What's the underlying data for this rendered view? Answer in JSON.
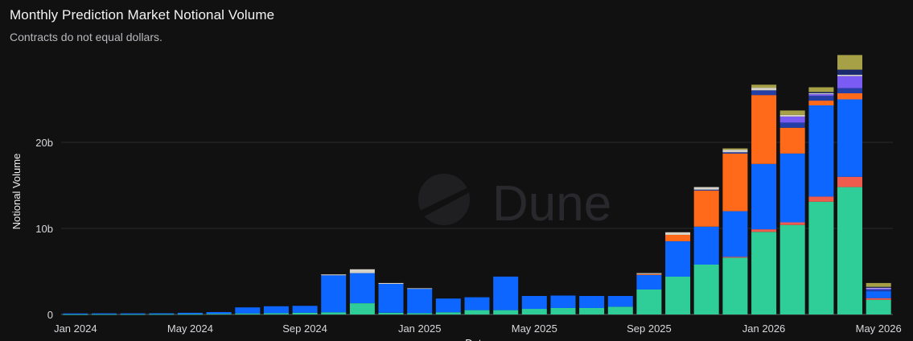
{
  "header": {
    "title": "Monthly Prediction Market Notional Volume",
    "subtitle": "Contracts do not equal dollars."
  },
  "watermark": {
    "text": "Dune",
    "icon": "dune-logo-icon"
  },
  "chart_data": {
    "type": "bar",
    "stacked": true,
    "title": "Monthly Prediction Market Notional Volume",
    "subtitle": "Contracts do not equal dollars.",
    "ylabel": "Notional Volume",
    "xlabel": "Date",
    "ylim": [
      0,
      30
    ],
    "y_unit": "b",
    "yticks": [
      {
        "value": 0,
        "label": "0"
      },
      {
        "value": 10,
        "label": "10b"
      },
      {
        "value": 20,
        "label": "20b"
      }
    ],
    "xtick_labels": [
      {
        "index": 0,
        "label": "Jan 2024"
      },
      {
        "index": 4,
        "label": "May 2024"
      },
      {
        "index": 8,
        "label": "Sep 2024"
      },
      {
        "index": 12,
        "label": "Jan 2025"
      },
      {
        "index": 16,
        "label": "May 2025"
      },
      {
        "index": 20,
        "label": "Sep 2025"
      },
      {
        "index": 24,
        "label": "Jan 2026"
      },
      {
        "index": 28,
        "label": "May 2026"
      }
    ],
    "grid": true,
    "legend": "none",
    "categories": [
      "2024-01",
      "2024-02",
      "2024-03",
      "2024-04",
      "2024-05",
      "2024-06",
      "2024-07",
      "2024-08",
      "2024-09",
      "2024-10",
      "2024-11",
      "2024-12",
      "2025-01",
      "2025-02",
      "2025-03",
      "2025-04",
      "2025-05",
      "2025-06",
      "2025-07",
      "2025-08",
      "2025-09",
      "2025-10",
      "2025-11",
      "2025-12",
      "2026-01",
      "2026-02",
      "2026-03",
      "2026-04",
      "2026-05"
    ],
    "series": [
      {
        "color": "#2fcd97",
        "values": [
          0.02,
          0.03,
          0.03,
          0.04,
          0.05,
          0.08,
          0.12,
          0.15,
          0.2,
          0.25,
          1.3,
          0.2,
          0.15,
          0.25,
          0.5,
          0.5,
          0.65,
          0.75,
          0.75,
          0.9,
          2.9,
          4.4,
          5.8,
          6.6,
          9.6,
          10.4,
          13.1,
          14.8,
          1.7
        ]
      },
      {
        "color": "#ef5b4c",
        "values": [
          0,
          0,
          0,
          0,
          0,
          0,
          0,
          0,
          0,
          0,
          0,
          0,
          0,
          0,
          0,
          0,
          0,
          0,
          0,
          0,
          0,
          0,
          0,
          0.1,
          0.3,
          0.3,
          0.6,
          1.2,
          0.2
        ]
      },
      {
        "color": "#0c66ff",
        "values": [
          0.1,
          0.1,
          0.1,
          0.1,
          0.15,
          0.2,
          0.7,
          0.8,
          0.8,
          4.3,
          3.5,
          3.35,
          2.85,
          1.6,
          1.5,
          3.9,
          1.5,
          1.45,
          1.4,
          1.25,
          1.7,
          4.1,
          4.4,
          5.3,
          7.6,
          8.0,
          10.6,
          9.0,
          0.8
        ]
      },
      {
        "color": "#ff6a1a",
        "values": [
          0,
          0,
          0,
          0,
          0,
          0,
          0,
          0,
          0,
          0,
          0,
          0,
          0,
          0,
          0,
          0,
          0,
          0,
          0,
          0,
          0.1,
          0.75,
          4.2,
          6.7,
          8.0,
          3.0,
          0.55,
          0.7,
          0
        ]
      },
      {
        "color": "#2440a8",
        "values": [
          0,
          0,
          0,
          0,
          0,
          0,
          0,
          0,
          0,
          0,
          0,
          0,
          0,
          0,
          0,
          0,
          0,
          0,
          0,
          0,
          0,
          0,
          0.1,
          0.15,
          0.55,
          0.6,
          0.55,
          0.6,
          0.2
        ]
      },
      {
        "color": "#7a5cf5",
        "values": [
          0,
          0,
          0,
          0,
          0,
          0,
          0,
          0,
          0,
          0,
          0,
          0,
          0,
          0,
          0,
          0,
          0,
          0,
          0,
          0,
          0,
          0,
          0,
          0,
          0,
          0.7,
          0.2,
          1.4,
          0.15
        ]
      },
      {
        "color": "#d7d2c8",
        "values": [
          0,
          0,
          0,
          0,
          0,
          0,
          0,
          0,
          0,
          0.1,
          0.45,
          0.1,
          0.05,
          0,
          0,
          0,
          0,
          0,
          0,
          0,
          0.1,
          0.3,
          0.3,
          0.3,
          0.3,
          0.2,
          0.1,
          0.15,
          0.05
        ]
      },
      {
        "color": "#1a2a6e",
        "values": [
          0,
          0,
          0,
          0,
          0,
          0,
          0,
          0,
          0,
          0,
          0,
          0,
          0,
          0,
          0,
          0,
          0,
          0,
          0,
          0,
          0,
          0,
          0,
          0,
          0,
          0,
          0.15,
          0.6,
          0.1
        ]
      },
      {
        "color": "#a6a046",
        "values": [
          0,
          0,
          0,
          0,
          0,
          0,
          0,
          0,
          0,
          0,
          0,
          0,
          0,
          0,
          0,
          0,
          0,
          0,
          0,
          0,
          0,
          0,
          0,
          0.15,
          0.35,
          0.5,
          0.55,
          1.7,
          0.45
        ]
      }
    ]
  }
}
